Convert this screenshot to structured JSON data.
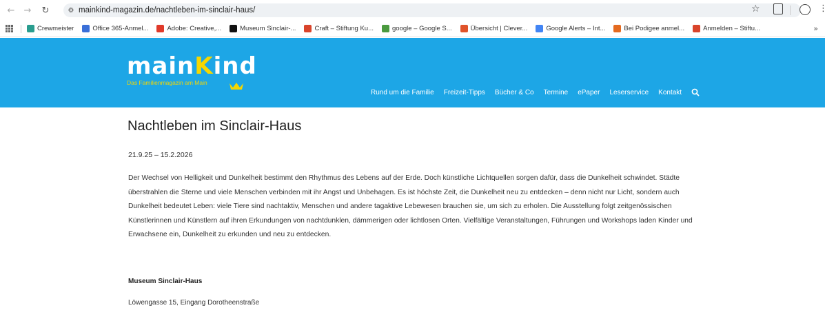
{
  "browser": {
    "url": "mainkind-magazin.de/nachtleben-im-sinclair-haus/",
    "bookmarks": [
      {
        "label": "Crewmeister",
        "color": "#2a9d8f",
        "glyph": "C"
      },
      {
        "label": "Office 365-Anmel...",
        "color": "#3a6fd8",
        "glyph": "O"
      },
      {
        "label": "Adobe: Creative,...",
        "color": "#e03a2a",
        "glyph": "A"
      },
      {
        "label": "Museum Sinclair-...",
        "color": "#111111",
        "glyph": "KN"
      },
      {
        "label": "Craft – Stiftung Ku...",
        "color": "#d9442b",
        "glyph": "C"
      },
      {
        "label": "google – Google S...",
        "color": "#4a9a3f",
        "glyph": "G"
      },
      {
        "label": "Übersicht | Clever...",
        "color": "#e0532a",
        "glyph": "C"
      },
      {
        "label": "Google Alerts – Int...",
        "color": "#4285f4",
        "glyph": "G"
      },
      {
        "label": "Bei Podigee anmel...",
        "color": "#e46a1f",
        "glyph": "P"
      },
      {
        "label": "Anmelden – Stiftu...",
        "color": "#d9442b",
        "glyph": "A"
      }
    ]
  },
  "site": {
    "logo_word_a": "main",
    "logo_word_b": "K",
    "logo_word_c": "ind",
    "tagline": "Das Familienmagazin am Main",
    "nav": [
      "Rund um die Familie",
      "Freizeit-Tipps",
      "Bücher & Co",
      "Termine",
      "ePaper",
      "Leserservice",
      "Kontakt"
    ],
    "header_color": "#1da6e6",
    "accent_color": "#f6d700"
  },
  "article": {
    "title": "Nachtleben im Sinclair-Haus",
    "date": "21.9.25 – 15.2.2026",
    "body": "Der Wechsel von Helligkeit und Dunkelheit bestimmt den Rhythmus des Lebens auf der Erde. Doch künstliche Lichtquellen sorgen dafür, dass die Dunkelheit schwindet. Städte überstrahlen die Sterne und viele Menschen verbinden mit ihr Angst und Unbehagen. Es ist höchste Zeit, die Dunkelheit neu zu entdecken – denn nicht nur Licht, sondern auch Dunkelheit bedeutet Leben: viele Tiere sind nachtaktiv, Menschen und andere tagaktive Lebewesen brauchen sie, um sich zu erholen. Die Ausstellung folgt zeitgenössischen Künstlerinnen und Künstlern auf ihren Erkundungen von nachtdunklen, dämmerigen oder lichtlosen Orten. Vielfältige Veranstaltungen, Führungen und Workshops laden Kinder und Erwachsene ein, Dunkelheit zu erkunden und neu zu entdecken.",
    "venue_name": "Museum Sinclair-Haus",
    "venue_address": "Löwengasse 15, Eingang Dorotheenstraße"
  }
}
